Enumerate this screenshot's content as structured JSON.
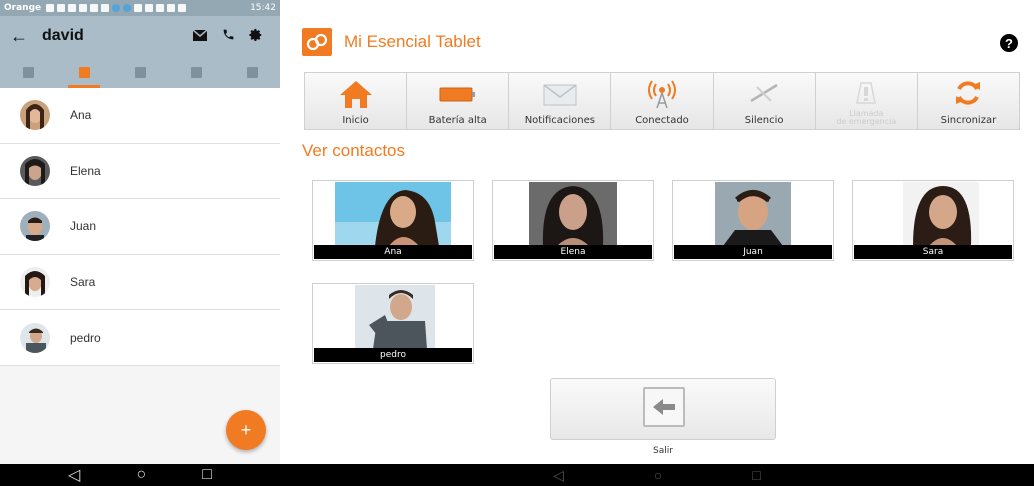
{
  "phone": {
    "status": {
      "carrier": "Orange",
      "time": "15:42"
    },
    "appbar": {
      "back_icon": "←",
      "title": "david"
    },
    "contacts": [
      {
        "name": "Ana"
      },
      {
        "name": "Elena"
      },
      {
        "name": "Juan"
      },
      {
        "name": "Sara"
      },
      {
        "name": "pedro"
      }
    ],
    "fab_label": "+",
    "nav": {
      "back": "◁",
      "home": "○",
      "recents": "□"
    },
    "accent": "#f07b22",
    "appbar_color": "#a9bcc7"
  },
  "tablet": {
    "title": "Mi Esencial Tablet",
    "help_label": "?",
    "toolbar": {
      "inicio": "Inicio",
      "bateria": "Batería alta",
      "notificaciones": "Notificaciones",
      "conectado": "Conectado",
      "silencio": "Silencio",
      "emergencia_l1": "Llamada",
      "emergencia_l2": "de emergencia",
      "sincronizar": "Sincronizar"
    },
    "section_title": "Ver contactos",
    "cards": [
      {
        "name": "Ana"
      },
      {
        "name": "Elena"
      },
      {
        "name": "Juan"
      },
      {
        "name": "Sara"
      },
      {
        "name": "pedro"
      }
    ],
    "exit_label": "Salir",
    "nav": {
      "back": "◁",
      "home": "○",
      "recents": "□"
    }
  }
}
